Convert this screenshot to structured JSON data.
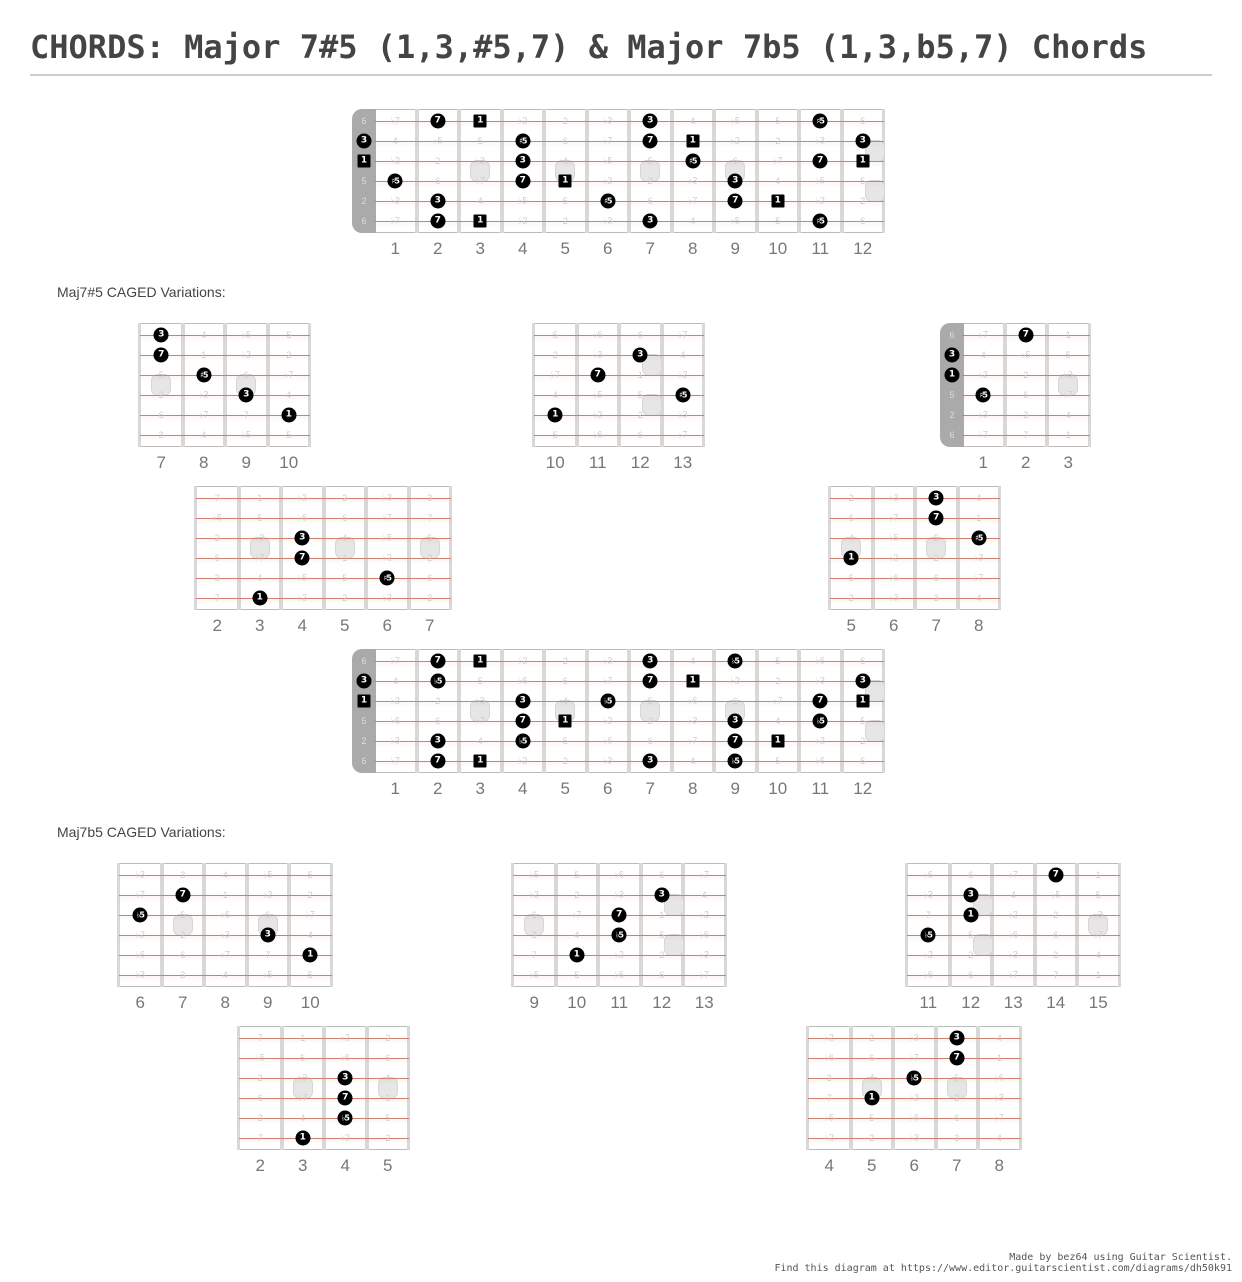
{
  "title": "CHORDS: Major 7#5 (1,3,#5,7) & Major 7b5 (1,3,b5,7) Chords",
  "tuning_intervals_open": [
    "6",
    "3",
    "1",
    "5",
    "2",
    "6"
  ],
  "interval_names_sharp5": [
    "1",
    "b2",
    "2",
    "b3",
    "3",
    "4",
    "b5",
    "5",
    "#5",
    "6",
    "b7",
    "7"
  ],
  "interval_names_flat6": [
    "1",
    "b2",
    "2",
    "b3",
    "3",
    "4",
    "b5",
    "5",
    "b6",
    "6",
    "b7",
    "7"
  ],
  "open_offsets_semitones": [
    9,
    4,
    0,
    7,
    2,
    9
  ],
  "inlay_frets": [
    3,
    5,
    7,
    9,
    12,
    15
  ],
  "sections": [
    {
      "label": "Maj7#5 CAGED Variations:"
    },
    {
      "label": "Maj7b5 CAGED Variations:"
    }
  ],
  "diagrams": [
    {
      "id": "maj7s5-full",
      "first_fret": 1,
      "last_fret": 12,
      "nut": true,
      "naming": "sharp5",
      "notes": [
        {
          "s": 1,
          "f": 2,
          "t": "7"
        },
        {
          "s": 1,
          "f": 3,
          "t": "1",
          "root": true
        },
        {
          "s": 1,
          "f": 7,
          "t": "3"
        },
        {
          "s": 1,
          "f": 11,
          "t": "#5"
        },
        {
          "s": 2,
          "f": 0,
          "t": "3"
        },
        {
          "s": 2,
          "f": 4,
          "t": "#5"
        },
        {
          "s": 2,
          "f": 7,
          "t": "7"
        },
        {
          "s": 2,
          "f": 8,
          "t": "1",
          "root": true
        },
        {
          "s": 2,
          "f": 12,
          "t": "3"
        },
        {
          "s": 3,
          "f": 0,
          "t": "1",
          "root": true
        },
        {
          "s": 3,
          "f": 4,
          "t": "3"
        },
        {
          "s": 3,
          "f": 8,
          "t": "#5"
        },
        {
          "s": 3,
          "f": 11,
          "t": "7"
        },
        {
          "s": 3,
          "f": 12,
          "t": "1",
          "root": true
        },
        {
          "s": 4,
          "f": 1,
          "t": "#5"
        },
        {
          "s": 4,
          "f": 4,
          "t": "7"
        },
        {
          "s": 4,
          "f": 5,
          "t": "1",
          "root": true
        },
        {
          "s": 4,
          "f": 9,
          "t": "3"
        },
        {
          "s": 5,
          "f": 2,
          "t": "3"
        },
        {
          "s": 5,
          "f": 6,
          "t": "#5"
        },
        {
          "s": 5,
          "f": 9,
          "t": "7"
        },
        {
          "s": 5,
          "f": 10,
          "t": "1",
          "root": true
        },
        {
          "s": 6,
          "f": 2,
          "t": "7"
        },
        {
          "s": 6,
          "f": 3,
          "t": "1",
          "root": true
        },
        {
          "s": 6,
          "f": 7,
          "t": "3"
        },
        {
          "s": 6,
          "f": 11,
          "t": "#5"
        }
      ]
    },
    {
      "id": "maj7s5-v1",
      "first_fret": 7,
      "last_fret": 10,
      "nut": false,
      "naming": "sharp5",
      "notes": [
        {
          "s": 1,
          "f": 7,
          "t": "3"
        },
        {
          "s": 2,
          "f": 7,
          "t": "7"
        },
        {
          "s": 3,
          "f": 8,
          "t": "#5"
        },
        {
          "s": 4,
          "f": 9,
          "t": "3"
        },
        {
          "s": 5,
          "f": 10,
          "t": "1"
        }
      ]
    },
    {
      "id": "maj7s5-v2",
      "first_fret": 10,
      "last_fret": 13,
      "nut": false,
      "naming": "flat6",
      "notes": [
        {
          "s": 2,
          "f": 12,
          "t": "3"
        },
        {
          "s": 3,
          "f": 11,
          "t": "7"
        },
        {
          "s": 4,
          "f": 13,
          "t": "#5"
        },
        {
          "s": 5,
          "f": 10,
          "t": "1"
        }
      ]
    },
    {
      "id": "maj7s5-v3",
      "first_fret": 1,
      "last_fret": 3,
      "nut": true,
      "naming": "flat6",
      "notes": [
        {
          "s": 1,
          "f": 2,
          "t": "7"
        },
        {
          "s": 2,
          "f": 0,
          "t": "3"
        },
        {
          "s": 3,
          "f": 0,
          "t": "1"
        },
        {
          "s": 4,
          "f": 1,
          "t": "#5"
        }
      ]
    },
    {
      "id": "maj7s5-v4",
      "first_fret": 2,
      "last_fret": 7,
      "nut": false,
      "naming": "flat6",
      "notes": [
        {
          "s": 3,
          "f": 4,
          "t": "3"
        },
        {
          "s": 4,
          "f": 4,
          "t": "7"
        },
        {
          "s": 5,
          "f": 6,
          "t": "#5"
        },
        {
          "s": 6,
          "f": 3,
          "t": "1"
        }
      ]
    },
    {
      "id": "maj7s5-v5",
      "first_fret": 5,
      "last_fret": 8,
      "nut": false,
      "naming": "flat6",
      "notes": [
        {
          "s": 1,
          "f": 7,
          "t": "3"
        },
        {
          "s": 2,
          "f": 7,
          "t": "7"
        },
        {
          "s": 3,
          "f": 8,
          "t": "#5"
        },
        {
          "s": 4,
          "f": 5,
          "t": "1"
        }
      ]
    },
    {
      "id": "maj7b5-full",
      "first_fret": 1,
      "last_fret": 12,
      "nut": true,
      "naming": "flat6",
      "notes": [
        {
          "s": 1,
          "f": 2,
          "t": "7"
        },
        {
          "s": 1,
          "f": 3,
          "t": "1",
          "root": true
        },
        {
          "s": 1,
          "f": 7,
          "t": "3"
        },
        {
          "s": 1,
          "f": 9,
          "t": "b5"
        },
        {
          "s": 2,
          "f": 0,
          "t": "3"
        },
        {
          "s": 2,
          "f": 2,
          "t": "b5"
        },
        {
          "s": 2,
          "f": 7,
          "t": "7"
        },
        {
          "s": 2,
          "f": 8,
          "t": "1",
          "root": true
        },
        {
          "s": 2,
          "f": 12,
          "t": "3"
        },
        {
          "s": 3,
          "f": 0,
          "t": "1",
          "root": true
        },
        {
          "s": 3,
          "f": 4,
          "t": "3"
        },
        {
          "s": 3,
          "f": 6,
          "t": "b5"
        },
        {
          "s": 3,
          "f": 11,
          "t": "7"
        },
        {
          "s": 3,
          "f": 12,
          "t": "1",
          "root": true
        },
        {
          "s": 4,
          "f": 4,
          "t": "7"
        },
        {
          "s": 4,
          "f": 5,
          "t": "1",
          "root": true
        },
        {
          "s": 4,
          "f": 9,
          "t": "3"
        },
        {
          "s": 4,
          "f": 11,
          "t": "b5"
        },
        {
          "s": 5,
          "f": 2,
          "t": "3"
        },
        {
          "s": 5,
          "f": 4,
          "t": "b5"
        },
        {
          "s": 5,
          "f": 9,
          "t": "7"
        },
        {
          "s": 5,
          "f": 10,
          "t": "1",
          "root": true
        },
        {
          "s": 6,
          "f": 2,
          "t": "7"
        },
        {
          "s": 6,
          "f": 3,
          "t": "1",
          "root": true
        },
        {
          "s": 6,
          "f": 7,
          "t": "3"
        },
        {
          "s": 6,
          "f": 9,
          "t": "b5"
        }
      ]
    },
    {
      "id": "maj7b5-v1",
      "first_fret": 6,
      "last_fret": 10,
      "nut": false,
      "naming": "flat6",
      "notes": [
        {
          "s": 2,
          "f": 7,
          "t": "7"
        },
        {
          "s": 3,
          "f": 6,
          "t": "b5"
        },
        {
          "s": 4,
          "f": 9,
          "t": "3"
        },
        {
          "s": 5,
          "f": 10,
          "t": "1"
        }
      ]
    },
    {
      "id": "maj7b5-v2",
      "first_fret": 9,
      "last_fret": 13,
      "nut": false,
      "naming": "flat6",
      "notes": [
        {
          "s": 2,
          "f": 12,
          "t": "3"
        },
        {
          "s": 3,
          "f": 11,
          "t": "7"
        },
        {
          "s": 4,
          "f": 11,
          "t": "b5"
        },
        {
          "s": 5,
          "f": 10,
          "t": "1"
        }
      ]
    },
    {
      "id": "maj7b5-v3",
      "first_fret": 11,
      "last_fret": 15,
      "nut": false,
      "naming": "flat6",
      "notes": [
        {
          "s": 1,
          "f": 14,
          "t": "7"
        },
        {
          "s": 2,
          "f": 12,
          "t": "3"
        },
        {
          "s": 3,
          "f": 12,
          "t": "1"
        },
        {
          "s": 4,
          "f": 11,
          "t": "b5"
        }
      ]
    },
    {
      "id": "maj7b5-v4",
      "first_fret": 2,
      "last_fret": 5,
      "nut": false,
      "naming": "flat6",
      "notes": [
        {
          "s": 3,
          "f": 4,
          "t": "3"
        },
        {
          "s": 4,
          "f": 4,
          "t": "7"
        },
        {
          "s": 5,
          "f": 4,
          "t": "b5"
        },
        {
          "s": 6,
          "f": 3,
          "t": "1"
        }
      ]
    },
    {
      "id": "maj7b5-v5",
      "first_fret": 4,
      "last_fret": 8,
      "nut": false,
      "naming": "flat6",
      "notes": [
        {
          "s": 1,
          "f": 7,
          "t": "3"
        },
        {
          "s": 2,
          "f": 7,
          "t": "7"
        },
        {
          "s": 3,
          "f": 6,
          "t": "b5"
        },
        {
          "s": 4,
          "f": 5,
          "t": "1"
        }
      ]
    }
  ],
  "footer": {
    "line1": "Made by bez64 using Guitar Scientist.",
    "line2": "Find this diagram at https://www.editor.guitarscientist.com/diagrams/dh50k91"
  }
}
